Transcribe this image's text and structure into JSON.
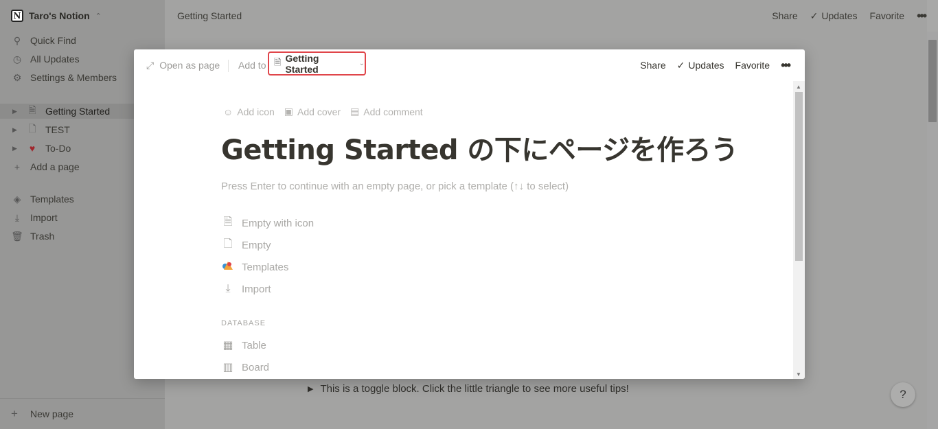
{
  "app": {
    "workspace_name": "Taro's Notion",
    "workspace_logo": "N",
    "breadcrumb": "Getting Started"
  },
  "sidebar": {
    "nav": [
      {
        "label": "Quick Find",
        "icon": "search-icon"
      },
      {
        "label": "All Updates",
        "icon": "clock-icon"
      },
      {
        "label": "Settings & Members",
        "icon": "gear-icon"
      }
    ],
    "pages": [
      {
        "label": "Getting Started",
        "icon": "document-icon",
        "active": true
      },
      {
        "label": "TEST",
        "icon": "page-icon"
      },
      {
        "label": "To-Do",
        "icon": "ribbon-icon"
      }
    ],
    "add_page": "Add a page",
    "tools": [
      {
        "label": "Templates",
        "icon": "templates-icon"
      },
      {
        "label": "Import",
        "icon": "download-icon"
      },
      {
        "label": "Trash",
        "icon": "trash-icon"
      }
    ],
    "new_page": "New page"
  },
  "topbar": {
    "share": "Share",
    "updates": "Updates",
    "favorite": "Favorite"
  },
  "background": {
    "toggle_text": "This is a toggle block. Click the little triangle to see more useful tips!",
    "help": "?"
  },
  "modal": {
    "open_as_page": "Open as page",
    "add_to": "Add to",
    "target_page": "Getting Started",
    "share": "Share",
    "updates": "Updates",
    "favorite": "Favorite",
    "add_icon": "Add icon",
    "add_cover": "Add cover",
    "add_comment": "Add comment",
    "title": "Getting Started の下にページを作ろう",
    "hint": "Press Enter to continue with an empty page, or pick a template (↑↓ to select)",
    "options": [
      {
        "label": "Empty with icon",
        "icon": "document-icon"
      },
      {
        "label": "Empty",
        "icon": "page-icon"
      },
      {
        "label": "Templates",
        "icon": "templates-icon"
      },
      {
        "label": "Import",
        "icon": "download-icon"
      }
    ],
    "database_label": "DATABASE",
    "database_options": [
      {
        "label": "Table",
        "icon": "table-icon"
      },
      {
        "label": "Board",
        "icon": "board-icon"
      }
    ],
    "highlight_color": "#e0454a"
  }
}
